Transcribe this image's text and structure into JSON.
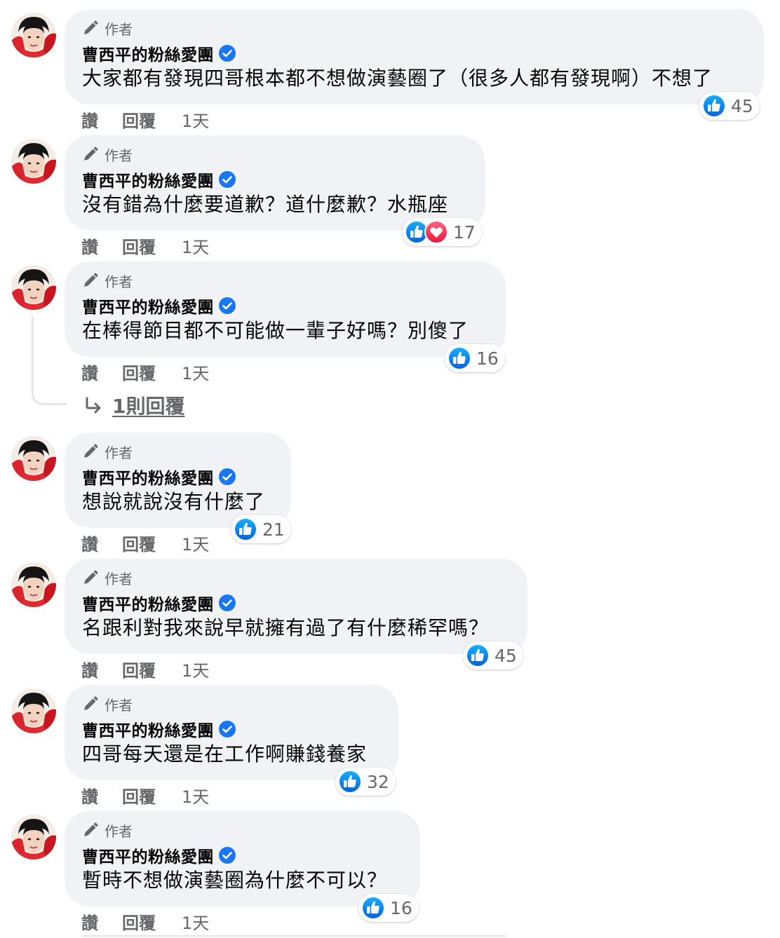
{
  "colors": {
    "accent": "#1877f2",
    "bubble": "#f0f2f5",
    "secondary_text": "#65676b",
    "heart": "#f33e58"
  },
  "comments": [
    {
      "author_label": "作者",
      "name": "曹西平的粉絲愛團",
      "text": "大家都有發現四哥根本都不想做演藝圈了（很多人都有發現啊）不想了",
      "like": "讚",
      "reply": "回覆",
      "time": "1天",
      "reactions": [
        "like-icon"
      ],
      "count": "45"
    },
    {
      "author_label": "作者",
      "name": "曹西平的粉絲愛團",
      "text": "沒有錯為什麼要道歉？道什麼歉？水瓶座",
      "like": "讚",
      "reply": "回覆",
      "time": "1天",
      "reactions": [
        "like-icon",
        "heart-icon"
      ],
      "count": "17"
    },
    {
      "author_label": "作者",
      "name": "曹西平的粉絲愛團",
      "text": "在棒得節目都不可能做一輩子好嗎？別傻了",
      "like": "讚",
      "reply": "回覆",
      "time": "1天",
      "reactions": [
        "like-icon"
      ],
      "count": "16"
    },
    {
      "author_label": "作者",
      "name": "曹西平的粉絲愛團",
      "text": "想說就說沒有什麼了",
      "like": "讚",
      "reply": "回覆",
      "time": "1天",
      "reactions": [
        "like-icon"
      ],
      "count": "21"
    },
    {
      "author_label": "作者",
      "name": "曹西平的粉絲愛團",
      "text": "名跟利對我來說早就擁有過了有什麼稀罕嗎？",
      "like": "讚",
      "reply": "回覆",
      "time": "1天",
      "reactions": [
        "like-icon"
      ],
      "count": "45"
    },
    {
      "author_label": "作者",
      "name": "曹西平的粉絲愛團",
      "text": "四哥每天還是在工作啊賺錢養家",
      "like": "讚",
      "reply": "回覆",
      "time": "1天",
      "reactions": [
        "like-icon"
      ],
      "count": "32"
    },
    {
      "author_label": "作者",
      "name": "曹西平的粉絲愛團",
      "text": "暫時不想做演藝圈為什麼不可以？",
      "like": "讚",
      "reply": "回覆",
      "time": "1天",
      "reactions": [
        "like-icon"
      ],
      "count": "16"
    }
  ],
  "replies_link": {
    "label": "1則回覆"
  }
}
